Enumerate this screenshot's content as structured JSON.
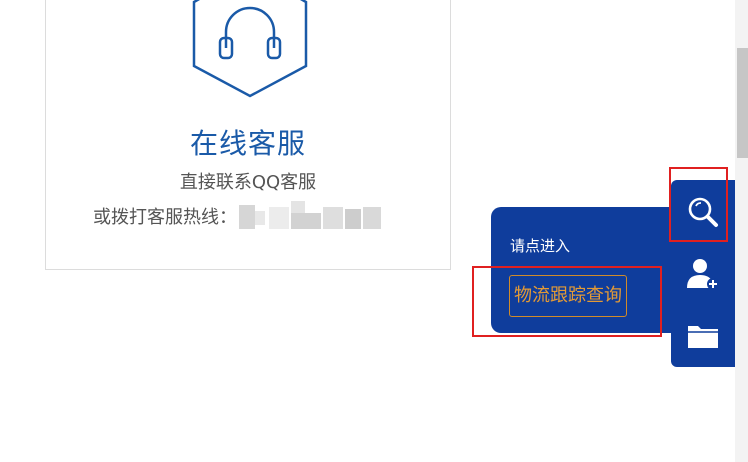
{
  "service_card": {
    "title": "在线客服",
    "subtitle": "直接联系QQ客服",
    "hotline_label": "或拨打客服热线："
  },
  "popup": {
    "label": "请点进入",
    "link_text": "物流跟踪查询"
  },
  "toolbar": {
    "buttons": [
      "search-icon",
      "add-user-icon",
      "folder-icon"
    ]
  },
  "colors": {
    "brand_blue": "#0f3d9c",
    "title_blue": "#1a5aa8",
    "link_orange": "#e39a36",
    "highlight_red": "#e02020"
  }
}
